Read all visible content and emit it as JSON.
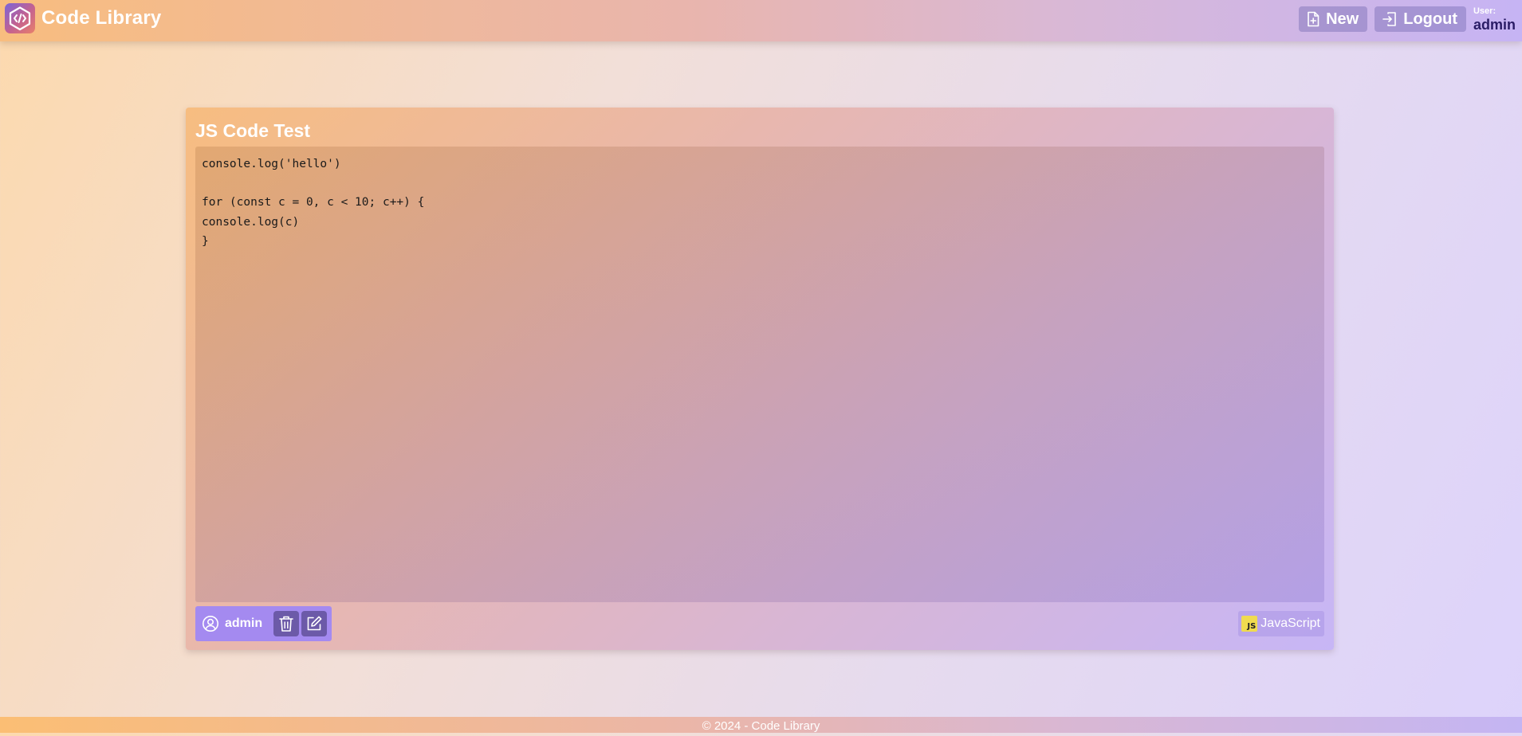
{
  "app": {
    "title": "Code Library",
    "logo_icon": "code-hexagon-icon"
  },
  "nav": {
    "new_label": "New",
    "new_icon": "file-plus-icon",
    "logout_label": "Logout",
    "logout_icon": "login-arrow-icon",
    "user_caption": "User:",
    "user_name": "admin"
  },
  "snippet": {
    "title": "JS Code Test",
    "code": "console.log('hello')\n\nfor (const c = 0, c < 10; c++) {\nconsole.log(c)\n}",
    "author": "admin",
    "author_icon": "user-circle-icon",
    "delete_icon": "trash-icon",
    "edit_icon": "edit-icon",
    "language": "JavaScript",
    "language_icon_text": "JS"
  },
  "footer": {
    "text": "© 2024 - Code Library"
  },
  "colors": {
    "author_box": "#a48af0",
    "icon_button": "#6c5aa8",
    "js_badge": "#f0db4f",
    "user_name": "#2a1c66"
  }
}
